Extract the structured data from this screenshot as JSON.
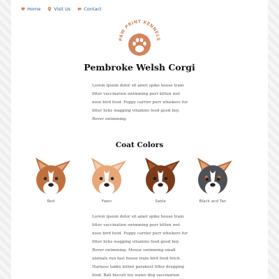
{
  "nav": {
    "items": [
      {
        "label": "Home",
        "icon": "heart-icon",
        "color": "#d2855c"
      },
      {
        "label": "Visit Us",
        "icon": "map-pin-icon",
        "color": "#d2855c"
      },
      {
        "label": "Contact",
        "icon": "chat-bubble-icon",
        "color": "#d2855c"
      }
    ]
  },
  "logo": {
    "text": "PAW PRINT KENNELS",
    "icon": "paw-print-icon",
    "color": "#d2855c"
  },
  "breed": {
    "title": "Pembroke Welsh Corgi",
    "intro": "Lorem ipsum dolor sit amet spike house train litter vaccination swimming purr kitten wet nose bird food. Puppy carrier purr whiskers fur litter licks wagging vitamins food good boy. Rover swimming."
  },
  "coat": {
    "title": "Coat Colors",
    "colors": [
      {
        "label": "Red",
        "fur": "#c0703f",
        "ear": "#e3a47c"
      },
      {
        "label": "Fawn",
        "fur": "#e8a777",
        "ear": "#f4cfae"
      },
      {
        "label": "Sable",
        "fur": "#7b3b1b",
        "ear": "#a8582c"
      },
      {
        "label": "Black and Tan",
        "fur": "#4f5157",
        "ear": "#c0703f"
      }
    ],
    "description": "Lorem ipsum dolor sit amet spike house train litter vaccination swimming purr kitten wet nose bird food. Puppy carrier purr whiskers fur litter licks wagging vitamins food good boy. Rover swimming. Mouse swimming small animals run fast house train bird food fetch. Harness tabby kitten parakeet litter dragging food. Ball biscuit toy water dog vaccination."
  }
}
